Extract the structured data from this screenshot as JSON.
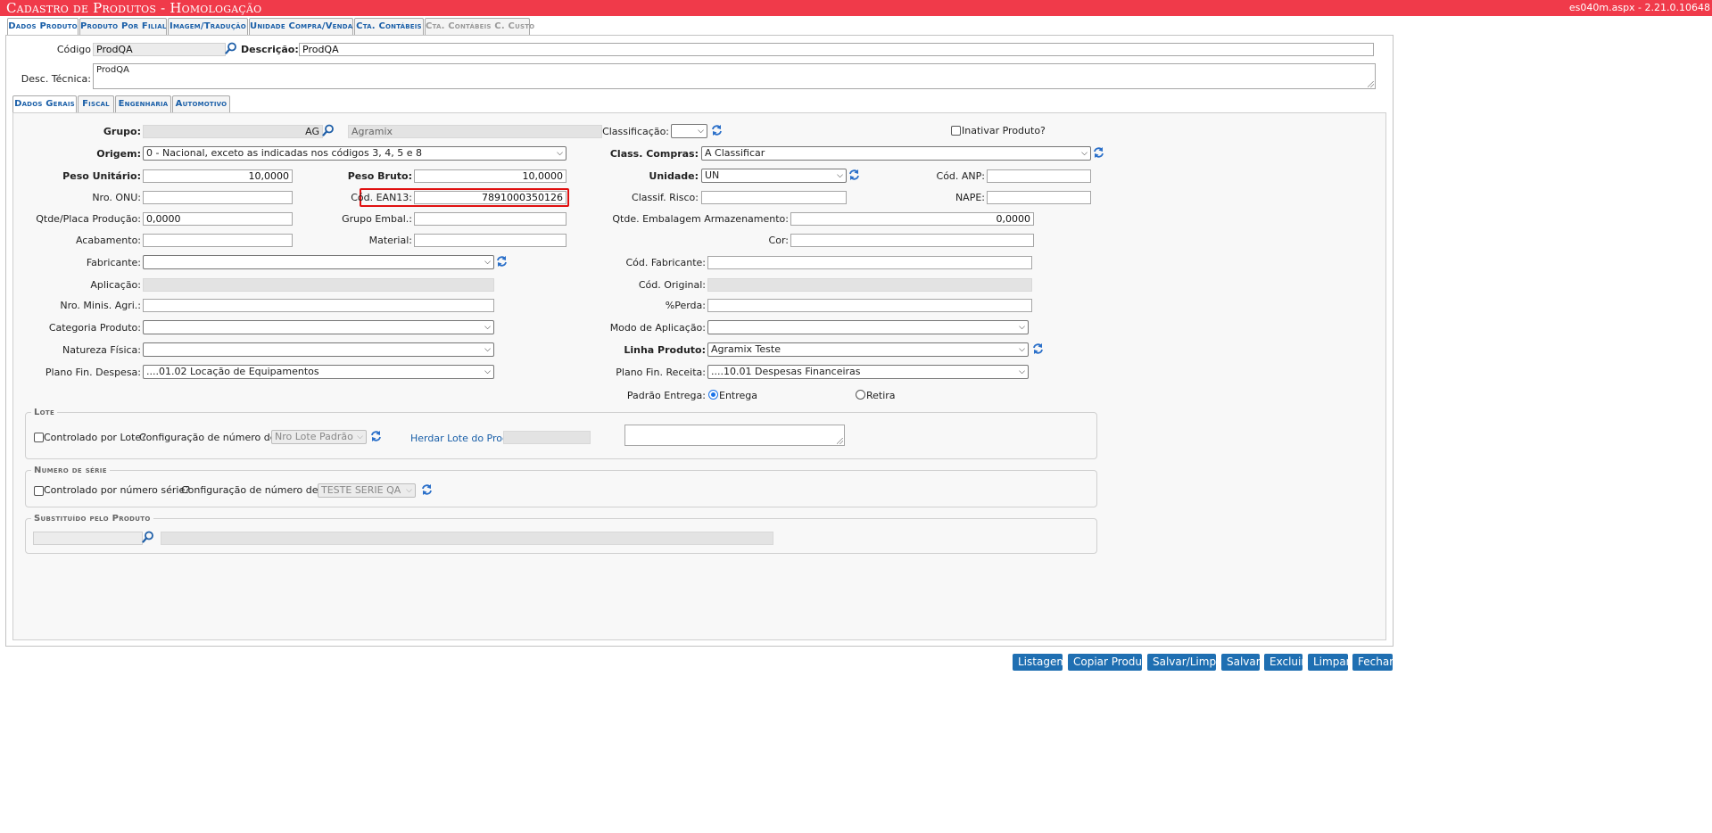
{
  "window": {
    "title": "Cadastro de Produtos  - Homologação",
    "version": "es040m.aspx - 2.21.0.10648"
  },
  "top_tabs": [
    {
      "label": "Dados Produto"
    },
    {
      "label": "Produto Por Filial"
    },
    {
      "label": "Imagem/Tradução"
    },
    {
      "label": "Unidade Compra/Venda"
    },
    {
      "label": "Cta. Contábeis"
    },
    {
      "label": "Cta. Contábeis C. Custo"
    }
  ],
  "header": {
    "codigo_label": "Código",
    "codigo_value": "ProdQA",
    "descricao_label": "Descrição:",
    "descricao_value": "ProdQA",
    "desc_tecnica_label": "Desc. Técnica:",
    "desc_tecnica_value": "ProdQA"
  },
  "sub_tabs": [
    {
      "label": "Dados Gerais"
    },
    {
      "label": "Fiscal"
    },
    {
      "label": "Engenharia"
    },
    {
      "label": "Automotivo"
    }
  ],
  "form": {
    "grupo_label": "Grupo:",
    "grupo_value": "AG",
    "grupo_desc": "Agramix",
    "classificacao_label": "Classificação:",
    "classificacao_value": "",
    "inativar_label": "Inativar Produto?",
    "origem_label": "Origem:",
    "origem_value": "0 - Nacional, exceto as indicadas nos códigos 3, 4, 5 e 8",
    "class_compras_label": "Class. Compras:",
    "class_compras_value": "A Classificar",
    "peso_unitario_label": "Peso Unitário:",
    "peso_unitario_value": "10,0000",
    "peso_bruto_label": "Peso Bruto:",
    "peso_bruto_value": "10,0000",
    "unidade_label": "Unidade:",
    "unidade_value": "UN",
    "cod_anp_label": "Cód. ANP:",
    "cod_anp_value": "",
    "nro_onu_label": "Nro. ONU:",
    "nro_onu_value": "",
    "cod_ean13_label": "Cód. EAN13:",
    "cod_ean13_value": "7891000350126",
    "classif_risco_label": "Classif. Risco:",
    "classif_risco_value": "",
    "nape_label": "NAPE:",
    "nape_value": "",
    "qtde_placa_label": "Qtde/Placa Produção:",
    "qtde_placa_value": "0,0000",
    "grupo_embal_label": "Grupo Embal.:",
    "grupo_embal_value": "",
    "qtde_embalagem_label": "Qtde. Embalagem Armazenamento:",
    "qtde_embalagem_value": "0,0000",
    "acabamento_label": "Acabamento:",
    "acabamento_value": "",
    "material_label": "Material:",
    "material_value": "",
    "cor_label": "Cor:",
    "cor_value": "",
    "fabricante_label": "Fabricante:",
    "fabricante_value": "",
    "cod_fabricante_label": "Cód. Fabricante:",
    "cod_fabricante_value": "",
    "aplicacao_label": "Aplicação:",
    "aplicacao_value": "",
    "cod_original_label": "Cód. Original:",
    "cod_original_value": "",
    "nro_minis_label": "Nro. Minis. Agri.:",
    "nro_minis_value": "",
    "perda_label": "%Perda:",
    "perda_value": "",
    "categoria_label": "Categoria Produto:",
    "categoria_value": "",
    "modo_aplicacao_label": "Modo de Aplicação:",
    "modo_aplicacao_value": "",
    "natureza_label": "Natureza Física:",
    "natureza_value": "",
    "linha_produto_label": "Linha Produto:",
    "linha_produto_value": "Agramix Teste",
    "plano_despesa_label": "Plano Fin. Despesa:",
    "plano_despesa_value": "....01.02 Locação de Equipamentos",
    "plano_receita_label": "Plano Fin. Receita:",
    "plano_receita_value": "....10.01 Despesas Financeiras",
    "padrao_entrega_label": "Padrão Entrega:",
    "entrega_label": "Entrega",
    "retira_label": "Retira"
  },
  "lote": {
    "legend": "Lote",
    "controlado_label": "Controlado por Lote?",
    "config_label": "Configuração de número de lote:",
    "config_value": "Nro Lote Padrão",
    "herdar_label": "Herdar Lote do Produto",
    "herdar_value": ""
  },
  "serie": {
    "legend": "Numero de série",
    "controlado_label": "Controlado por número série?",
    "config_label": "Configuração de número de série:",
    "config_value": "TESTE SERIE QA"
  },
  "substituido": {
    "legend": "Substituído pelo Produto",
    "code_value": "",
    "desc_value": ""
  },
  "buttons": {
    "listagem": "Listagem",
    "copiar": "Copiar Produto",
    "salvar_limpar": "Salvar/Limpar",
    "salvar": "Salvar",
    "excluir": "Excluir",
    "limpar": "Limpar",
    "fechar": "Fechar"
  },
  "colors": {
    "title_bar": "#f03a4a",
    "tab_text": "#1a5fa8",
    "button": "#1f6fb2",
    "highlight": "#e01010"
  }
}
